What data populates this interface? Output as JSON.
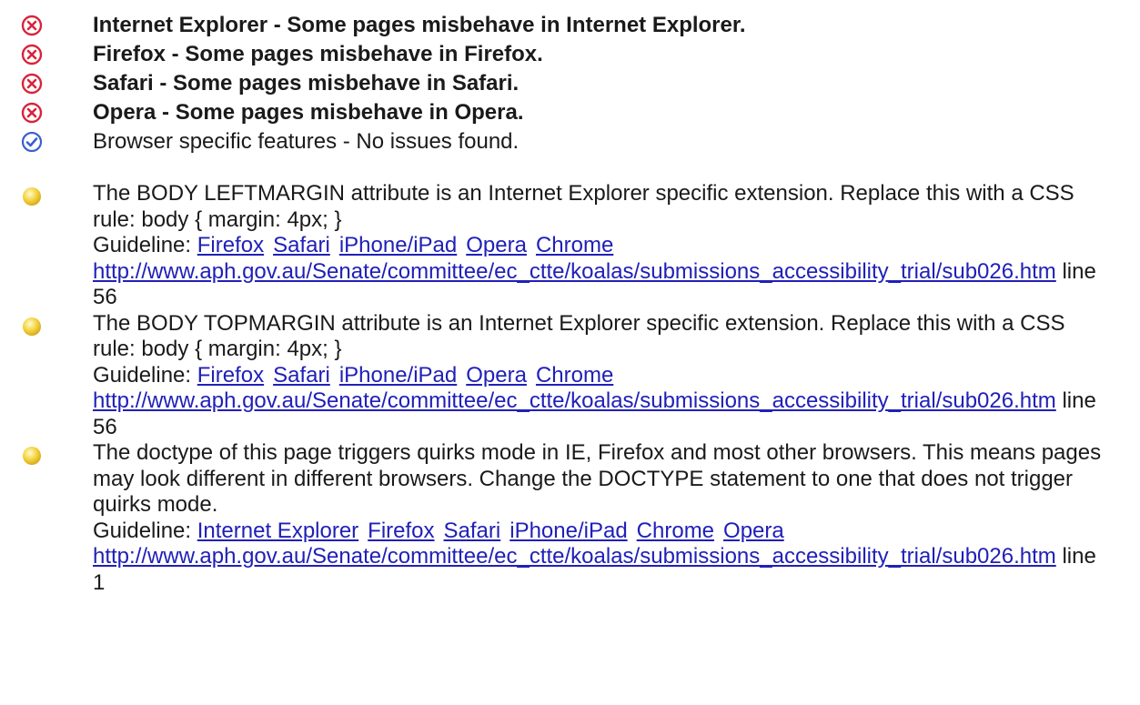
{
  "summary": [
    {
      "status": "error",
      "icon": "error-circle-icon",
      "text": "Internet Explorer - Some pages misbehave in Internet Explorer.",
      "bold": true
    },
    {
      "status": "error",
      "icon": "error-circle-icon",
      "text": "Firefox - Some pages misbehave in Firefox.",
      "bold": true
    },
    {
      "status": "error",
      "icon": "error-circle-icon",
      "text": "Safari - Some pages misbehave in Safari.",
      "bold": true
    },
    {
      "status": "error",
      "icon": "error-circle-icon",
      "text": "Opera - Some pages misbehave in Opera.",
      "bold": true
    },
    {
      "status": "ok",
      "icon": "check-circle-icon",
      "text": "Browser specific features - No issues found.",
      "bold": false
    }
  ],
  "issues": [
    {
      "icon": "warning-bullet-icon",
      "message": "The BODY LEFTMARGIN attribute is an Internet Explorer specific extension. Replace this with a CSS rule: body { margin: 4px; }",
      "guideline_label": "Guideline:",
      "guidelines": [
        "Firefox",
        "Safari",
        "iPhone/iPad",
        "Opera",
        "Chrome"
      ],
      "url": "http://www.aph.gov.au/Senate/committee/ec_ctte/koalas/submissions_accessibility_trial/sub026.htm",
      "line": "line 56"
    },
    {
      "icon": "warning-bullet-icon",
      "message": "The BODY TOPMARGIN attribute is an Internet Explorer specific extension. Replace this with a CSS rule: body { margin: 4px; }",
      "guideline_label": "Guideline:",
      "guidelines": [
        "Firefox",
        "Safari",
        "iPhone/iPad",
        "Opera",
        "Chrome"
      ],
      "url": "http://www.aph.gov.au/Senate/committee/ec_ctte/koalas/submissions_accessibility_trial/sub026.htm",
      "line": "line 56"
    },
    {
      "icon": "warning-bullet-icon",
      "message": "The doctype of this page triggers quirks mode in IE, Firefox and most other browsers. This means pages may look different in different browsers. Change the DOCTYPE statement to one that does not trigger quirks mode.",
      "guideline_label": "Guideline:",
      "guidelines": [
        "Internet Explorer",
        "Firefox",
        "Safari",
        "iPhone/iPad",
        "Chrome",
        "Opera"
      ],
      "url": "http://www.aph.gov.au/Senate/committee/ec_ctte/koalas/submissions_accessibility_trial/sub026.htm",
      "line": "line 1"
    }
  ],
  "colors": {
    "error": "#d8243a",
    "ok": "#3a5fd0",
    "warning": "#f2d23a",
    "link": "#2020b8"
  }
}
